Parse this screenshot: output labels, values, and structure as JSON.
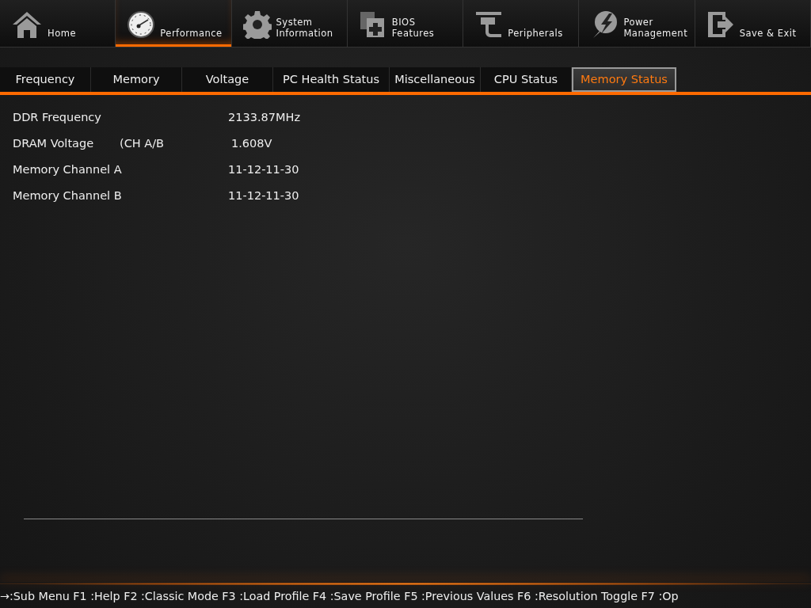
{
  "main_tabs": [
    {
      "kind": "home",
      "label_lines": [
        "Home"
      ],
      "selected": false
    },
    {
      "kind": "gauge",
      "label_lines": [
        "Performance"
      ],
      "selected": true
    },
    {
      "kind": "gear",
      "label_lines": [
        "System",
        "Information"
      ],
      "selected": false
    },
    {
      "kind": "chip",
      "label_lines": [
        "BIOS",
        "Features"
      ],
      "selected": false
    },
    {
      "kind": "plug",
      "label_lines": [
        "Peripherals"
      ],
      "selected": false
    },
    {
      "kind": "power",
      "label_lines": [
        "Power",
        "Management"
      ],
      "selected": false
    },
    {
      "kind": "exit",
      "label_lines": [
        "Save & Exit"
      ],
      "selected": false
    }
  ],
  "sub_tabs": [
    {
      "label": "Frequency",
      "selected": false
    },
    {
      "label": "Memory",
      "selected": false
    },
    {
      "label": "Voltage",
      "selected": false
    },
    {
      "label": "PC Health Status",
      "selected": false
    },
    {
      "label": "Miscellaneous",
      "selected": false
    },
    {
      "label": "CPU Status",
      "selected": false
    },
    {
      "label": "Memory Status",
      "selected": true
    }
  ],
  "rows": [
    {
      "label": "DDR Frequency",
      "value": "2133.87MHz"
    },
    {
      "label": "DRAM Voltage",
      "note": "(CH A/B",
      "value": "1.608V"
    },
    {
      "label": "Memory Channel A",
      "value": "11-12-11-30"
    },
    {
      "label": "Memory Channel B",
      "value": "11-12-11-30"
    }
  ],
  "status_bar": "→:Sub Menu F1 :Help F2 :Classic Mode F3 :Load Profile F4 :Save Profile F5 :Previous Values F6 :Resolution Toggle F7 :Op"
}
